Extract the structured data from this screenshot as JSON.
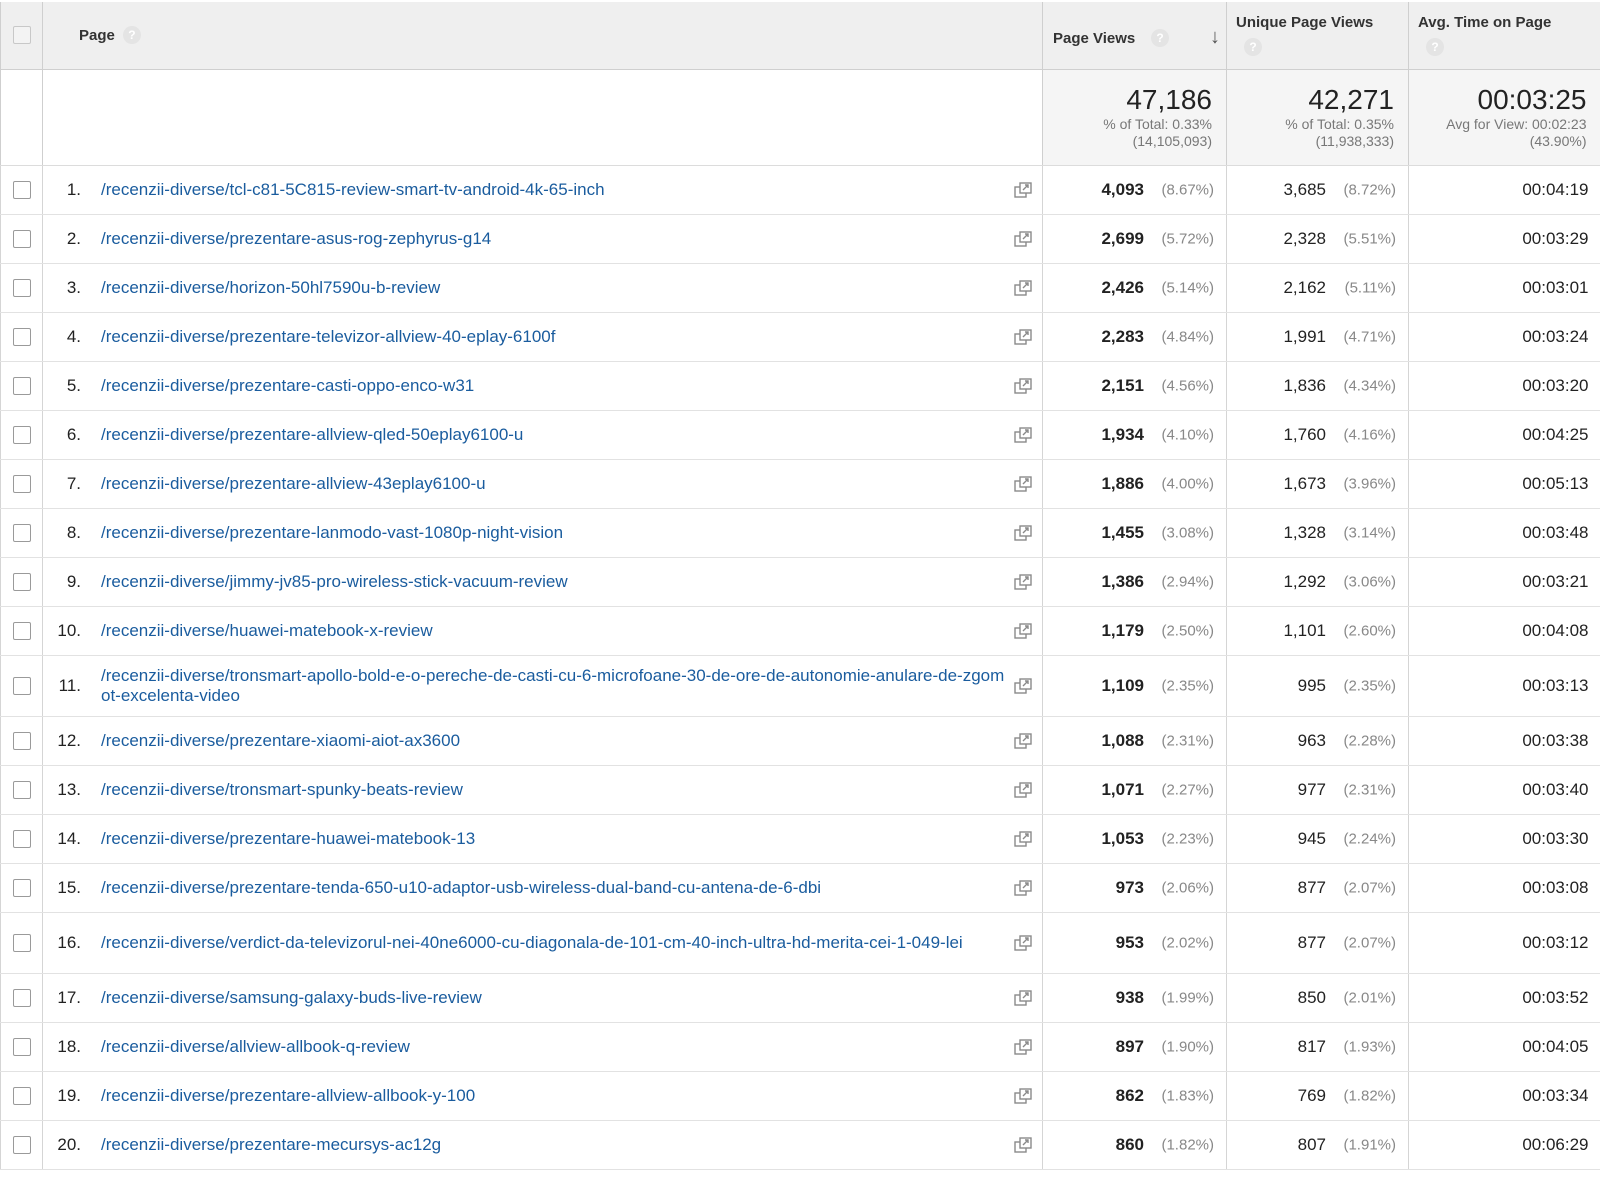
{
  "header": {
    "page_label": "Page",
    "page_views_label": "Page Views",
    "unique_page_views_label": "Unique Page Views",
    "avg_time_label": "Avg. Time on Page",
    "help_glyph": "?",
    "sort_glyph": "↓"
  },
  "totals": {
    "page_views": {
      "value": "47,186",
      "line1": "% of Total: 0.33%",
      "line2": "(14,105,093)"
    },
    "unique_page_views": {
      "value": "42,271",
      "line1": "% of Total: 0.35%",
      "line2": "(11,938,333)"
    },
    "avg_time": {
      "value": "00:03:25",
      "line1": "Avg for View: 00:02:23",
      "line2": "(43.90%)"
    }
  },
  "rows": [
    {
      "idx": "1.",
      "page": "/recenzii-diverse/tcl-c81-5C815-review-smart-tv-android-4k-65-inch",
      "pv": "4,093",
      "pv_pct": "(8.67%)",
      "upv": "3,685",
      "upv_pct": "(8.72%)",
      "avg": "00:04:19"
    },
    {
      "idx": "2.",
      "page": "/recenzii-diverse/prezentare-asus-rog-zephyrus-g14",
      "pv": "2,699",
      "pv_pct": "(5.72%)",
      "upv": "2,328",
      "upv_pct": "(5.51%)",
      "avg": "00:03:29"
    },
    {
      "idx": "3.",
      "page": "/recenzii-diverse/horizon-50hl7590u-b-review",
      "pv": "2,426",
      "pv_pct": "(5.14%)",
      "upv": "2,162",
      "upv_pct": "(5.11%)",
      "avg": "00:03:01"
    },
    {
      "idx": "4.",
      "page": "/recenzii-diverse/prezentare-televizor-allview-40-eplay-6100f",
      "pv": "2,283",
      "pv_pct": "(4.84%)",
      "upv": "1,991",
      "upv_pct": "(4.71%)",
      "avg": "00:03:24"
    },
    {
      "idx": "5.",
      "page": "/recenzii-diverse/prezentare-casti-oppo-enco-w31",
      "pv": "2,151",
      "pv_pct": "(4.56%)",
      "upv": "1,836",
      "upv_pct": "(4.34%)",
      "avg": "00:03:20"
    },
    {
      "idx": "6.",
      "page": "/recenzii-diverse/prezentare-allview-qled-50eplay6100-u",
      "pv": "1,934",
      "pv_pct": "(4.10%)",
      "upv": "1,760",
      "upv_pct": "(4.16%)",
      "avg": "00:04:25"
    },
    {
      "idx": "7.",
      "page": "/recenzii-diverse/prezentare-allview-43eplay6100-u",
      "pv": "1,886",
      "pv_pct": "(4.00%)",
      "upv": "1,673",
      "upv_pct": "(3.96%)",
      "avg": "00:05:13"
    },
    {
      "idx": "8.",
      "page": "/recenzii-diverse/prezentare-lanmodo-vast-1080p-night-vision",
      "pv": "1,455",
      "pv_pct": "(3.08%)",
      "upv": "1,328",
      "upv_pct": "(3.14%)",
      "avg": "00:03:48"
    },
    {
      "idx": "9.",
      "page": "/recenzii-diverse/jimmy-jv85-pro-wireless-stick-vacuum-review",
      "pv": "1,386",
      "pv_pct": "(2.94%)",
      "upv": "1,292",
      "upv_pct": "(3.06%)",
      "avg": "00:03:21"
    },
    {
      "idx": "10.",
      "page": "/recenzii-diverse/huawei-matebook-x-review",
      "pv": "1,179",
      "pv_pct": "(2.50%)",
      "upv": "1,101",
      "upv_pct": "(2.60%)",
      "avg": "00:04:08"
    },
    {
      "idx": "11.",
      "page": "/recenzii-diverse/tronsmart-apollo-bold-e-o-pereche-de-casti-cu-6-microfoane-30-de-ore-de-autonomie-anulare-de-zgomot-excelenta-video",
      "pv": "1,109",
      "pv_pct": "(2.35%)",
      "upv": "995",
      "upv_pct": "(2.35%)",
      "avg": "00:03:13"
    },
    {
      "idx": "12.",
      "page": "/recenzii-diverse/prezentare-xiaomi-aiot-ax3600",
      "pv": "1,088",
      "pv_pct": "(2.31%)",
      "upv": "963",
      "upv_pct": "(2.28%)",
      "avg": "00:03:38"
    },
    {
      "idx": "13.",
      "page": "/recenzii-diverse/tronsmart-spunky-beats-review",
      "pv": "1,071",
      "pv_pct": "(2.27%)",
      "upv": "977",
      "upv_pct": "(2.31%)",
      "avg": "00:03:40"
    },
    {
      "idx": "14.",
      "page": "/recenzii-diverse/prezentare-huawei-matebook-13",
      "pv": "1,053",
      "pv_pct": "(2.23%)",
      "upv": "945",
      "upv_pct": "(2.24%)",
      "avg": "00:03:30"
    },
    {
      "idx": "15.",
      "page": "/recenzii-diverse/prezentare-tenda-650-u10-adaptor-usb-wireless-dual-band-cu-antena-de-6-dbi",
      "pv": "973",
      "pv_pct": "(2.06%)",
      "upv": "877",
      "upv_pct": "(2.07%)",
      "avg": "00:03:08"
    },
    {
      "idx": "16.",
      "page": "/recenzii-diverse/verdict-da-televizorul-nei-40ne6000-cu-diagonala-de-101-cm-40-inch-ultra-hd-merita-cei-1-049-lei",
      "pv": "953",
      "pv_pct": "(2.02%)",
      "upv": "877",
      "upv_pct": "(2.07%)",
      "avg": "00:03:12"
    },
    {
      "idx": "17.",
      "page": "/recenzii-diverse/samsung-galaxy-buds-live-review",
      "pv": "938",
      "pv_pct": "(1.99%)",
      "upv": "850",
      "upv_pct": "(2.01%)",
      "avg": "00:03:52"
    },
    {
      "idx": "18.",
      "page": "/recenzii-diverse/allview-allbook-q-review",
      "pv": "897",
      "pv_pct": "(1.90%)",
      "upv": "817",
      "upv_pct": "(1.93%)",
      "avg": "00:04:05"
    },
    {
      "idx": "19.",
      "page": "/recenzii-diverse/prezentare-allview-allbook-y-100",
      "pv": "862",
      "pv_pct": "(1.83%)",
      "upv": "769",
      "upv_pct": "(1.82%)",
      "avg": "00:03:34"
    },
    {
      "idx": "20.",
      "page": "/recenzii-diverse/prezentare-mecursys-ac12g",
      "pv": "860",
      "pv_pct": "(1.82%)",
      "upv": "807",
      "upv_pct": "(1.91%)",
      "avg": "00:06:29"
    }
  ],
  "colors": {
    "link": "#1a5c9e",
    "header_bg": "#efefef",
    "totals_bg": "#f5f5f5"
  },
  "icons": {
    "row_action": "open-in-new-window-icon",
    "sort": "sort-descending-icon",
    "help": "help-icon"
  }
}
